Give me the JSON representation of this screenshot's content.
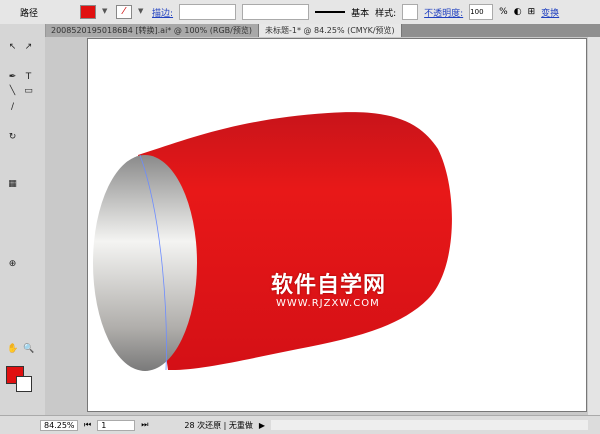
{
  "control": {
    "mode": "路径",
    "stroke_label": "描边:",
    "stroke_style": "基本",
    "style_label": "样式:",
    "opacity_label": "不透明度:",
    "opacity": "100",
    "percent": "%",
    "transform": "变换",
    "fill_color": "#e01010"
  },
  "tabs": [
    {
      "label": "20085201950186B4 [转换].ai* @ 100% (RGB/预览)"
    },
    {
      "label": "未标题-1* @ 84.25% (CMYK/预览)"
    }
  ],
  "watermark": {
    "title": "软件自学网",
    "url": "WWW.RJZXW.COM"
  },
  "status": {
    "zoom": "84.25%",
    "page": "1",
    "message": "28 次还原 | 无重做"
  }
}
